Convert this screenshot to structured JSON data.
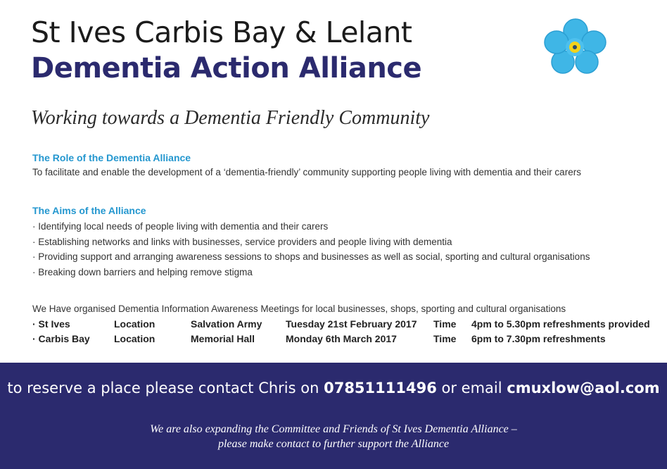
{
  "header": {
    "title_line1": "St Ives Carbis Bay & Lelant",
    "title_line2": "Dementia Action Alliance",
    "logo": "forget-me-not-flower-icon",
    "colors": {
      "navy": "#2b2a6e",
      "cyan_heading": "#2497cf",
      "flower_blue": "#3fb6e6",
      "flower_center": "#f2d21c"
    }
  },
  "tagline": "Working towards a Dementia Friendly Community",
  "role": {
    "heading": "The Role of the Dementia Alliance",
    "text": "To facilitate and enable the development of a ‘dementia-friendly’ community supporting people living with dementia and their carers"
  },
  "aims": {
    "heading": "The Aims of the Alliance",
    "items": [
      "Identifying local needs of people living with dementia and their carers",
      "Establishing networks and links with businesses, service providers and people living with dementia",
      "Providing support and arranging awareness sessions to shops and businesses as well as social, sporting and cultural organisations",
      "Breaking down barriers and helping remove stigma"
    ]
  },
  "meetings": {
    "intro": "We Have organised Dementia Information Awareness Meetings for local businesses, shops, sporting and cultural organisations",
    "rows": [
      {
        "place": "· St Ives",
        "location_label": "Location",
        "venue": "Salvation Army",
        "date": "Tuesday 21st February 2017",
        "time_label": "Time",
        "time": "4pm to 5.30pm refreshments provided"
      },
      {
        "place": "· Carbis Bay",
        "location_label": "Location",
        "venue": "Memorial Hall",
        "date": "Monday 6th March 2017",
        "time_label": "Time",
        "time": "6pm to 7.30pm refreshments"
      }
    ]
  },
  "contact": {
    "prefix": "to reserve a place please contact Chris on ",
    "phone": "07851111496",
    "middle": " or email ",
    "email": "cmuxlow@aol.com"
  },
  "footer": {
    "line1": "We are also expanding the Committee and Friends of St Ives Dementia Alliance –",
    "line2": "please make contact to further support the Alliance"
  }
}
